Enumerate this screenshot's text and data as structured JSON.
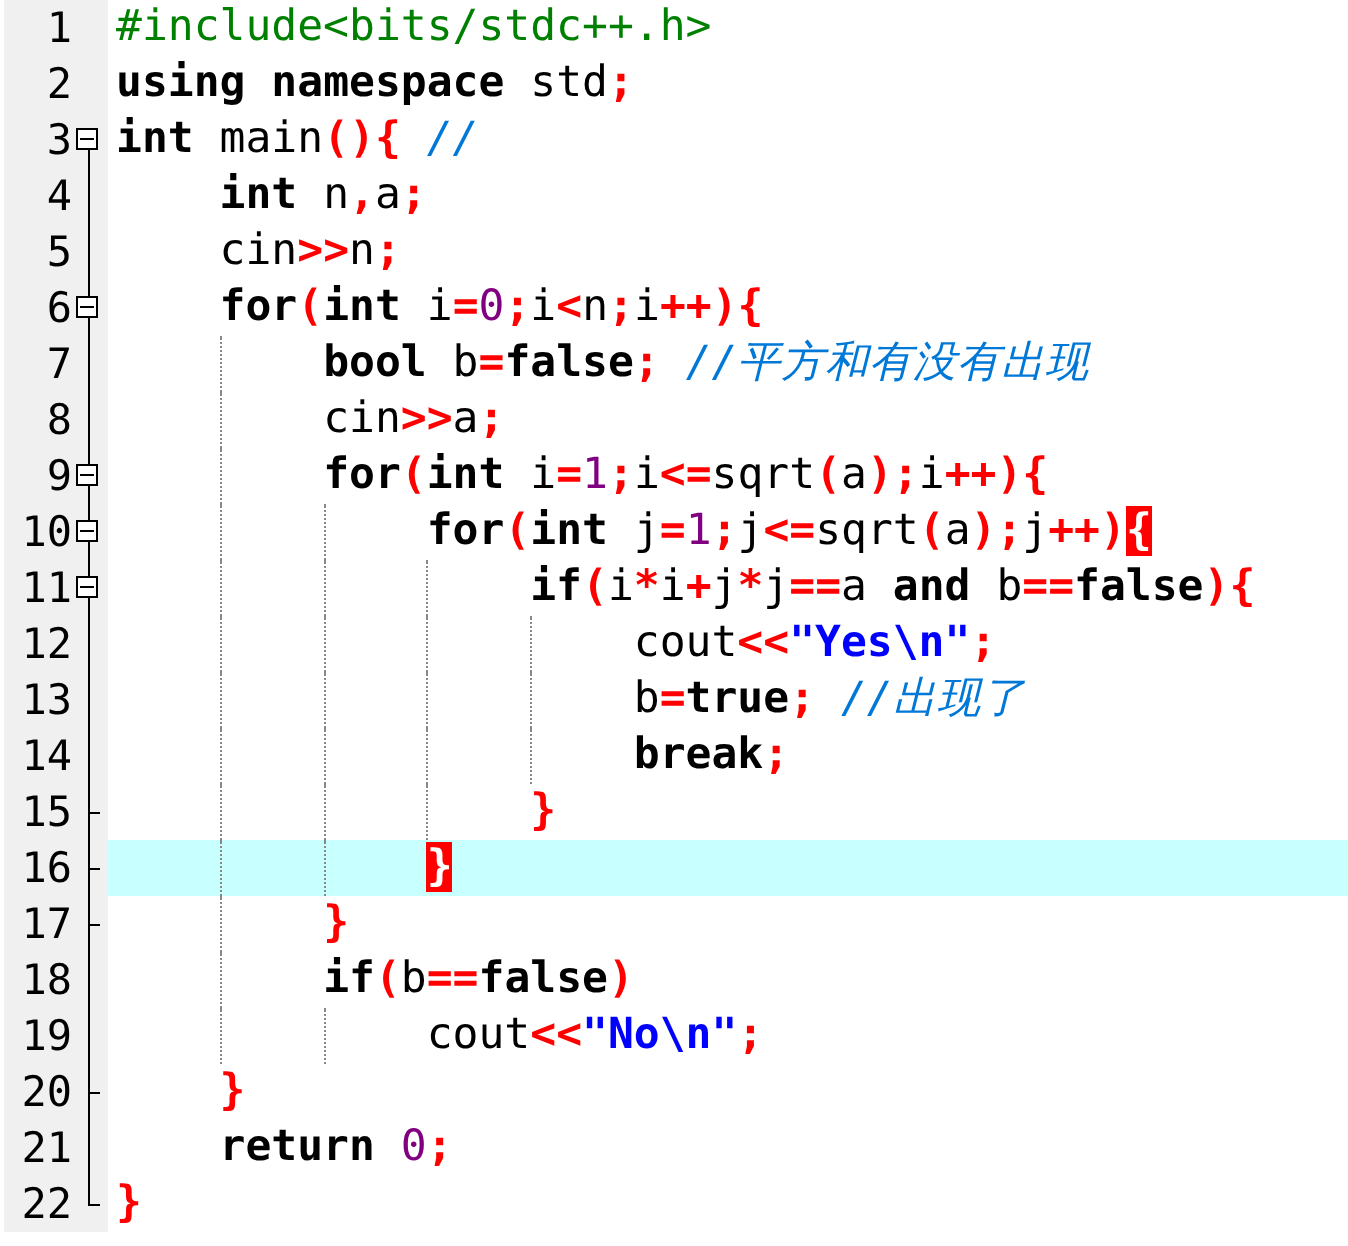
{
  "editor": {
    "lines": [
      {
        "number": "1",
        "current": false,
        "fold_start": false,
        "fold_end": false,
        "tokens": [
          {
            "text": "#include<bits/stdc++.h>",
            "kind": "preproc"
          }
        ]
      },
      {
        "number": "2",
        "current": false,
        "fold_start": false,
        "fold_end": false,
        "tokens": [
          {
            "text": "using",
            "kind": "keyword"
          },
          {
            "text": " namespace",
            "kind": "keyword"
          },
          {
            "text": " std",
            "kind": "plain"
          },
          {
            "text": ";",
            "kind": "symbol"
          }
        ]
      },
      {
        "number": "3",
        "current": false,
        "fold_start": true,
        "fold_end": false,
        "tokens": [
          {
            "text": "int",
            "kind": "keyword"
          },
          {
            "text": " main",
            "kind": "plain"
          },
          {
            "text": "(){",
            "kind": "symbol"
          },
          {
            "text": " //",
            "kind": "comment"
          }
        ]
      },
      {
        "number": "4",
        "current": false,
        "fold_start": false,
        "fold_end": false,
        "tokens": [
          {
            "text": "    int",
            "kind": "keyword"
          },
          {
            "text": " n",
            "kind": "plain"
          },
          {
            "text": ",",
            "kind": "symbol"
          },
          {
            "text": "a",
            "kind": "plain"
          },
          {
            "text": ";",
            "kind": "symbol"
          }
        ]
      },
      {
        "number": "5",
        "current": false,
        "fold_start": false,
        "fold_end": false,
        "tokens": [
          {
            "text": "    cin",
            "kind": "plain"
          },
          {
            "text": ">>",
            "kind": "symbol"
          },
          {
            "text": "n",
            "kind": "plain"
          },
          {
            "text": ";",
            "kind": "symbol"
          }
        ]
      },
      {
        "number": "6",
        "current": false,
        "fold_start": true,
        "fold_end": false,
        "tokens": [
          {
            "text": "    for",
            "kind": "keyword"
          },
          {
            "text": "(",
            "kind": "symbol"
          },
          {
            "text": "int",
            "kind": "keyword"
          },
          {
            "text": " i",
            "kind": "plain"
          },
          {
            "text": "=",
            "kind": "symbol"
          },
          {
            "text": "0",
            "kind": "number"
          },
          {
            "text": ";",
            "kind": "symbol"
          },
          {
            "text": "i",
            "kind": "plain"
          },
          {
            "text": "<",
            "kind": "symbol"
          },
          {
            "text": "n",
            "kind": "plain"
          },
          {
            "text": ";",
            "kind": "symbol"
          },
          {
            "text": "i",
            "kind": "plain"
          },
          {
            "text": "++){",
            "kind": "symbol"
          }
        ]
      },
      {
        "number": "7",
        "current": false,
        "fold_start": false,
        "fold_end": false,
        "tokens": [
          {
            "text": "        bool",
            "kind": "keyword"
          },
          {
            "text": " b",
            "kind": "plain"
          },
          {
            "text": "=",
            "kind": "symbol"
          },
          {
            "text": "false",
            "kind": "keyword"
          },
          {
            "text": ";",
            "kind": "symbol"
          },
          {
            "text": " //平方和有没有出现",
            "kind": "comment"
          }
        ]
      },
      {
        "number": "8",
        "current": false,
        "fold_start": false,
        "fold_end": false,
        "tokens": [
          {
            "text": "        cin",
            "kind": "plain"
          },
          {
            "text": ">>",
            "kind": "symbol"
          },
          {
            "text": "a",
            "kind": "plain"
          },
          {
            "text": ";",
            "kind": "symbol"
          }
        ]
      },
      {
        "number": "9",
        "current": false,
        "fold_start": true,
        "fold_end": false,
        "tokens": [
          {
            "text": "        for",
            "kind": "keyword"
          },
          {
            "text": "(",
            "kind": "symbol"
          },
          {
            "text": "int",
            "kind": "keyword"
          },
          {
            "text": " i",
            "kind": "plain"
          },
          {
            "text": "=",
            "kind": "symbol"
          },
          {
            "text": "1",
            "kind": "number"
          },
          {
            "text": ";",
            "kind": "symbol"
          },
          {
            "text": "i",
            "kind": "plain"
          },
          {
            "text": "<=",
            "kind": "symbol"
          },
          {
            "text": "sqrt",
            "kind": "plain"
          },
          {
            "text": "(",
            "kind": "symbol"
          },
          {
            "text": "a",
            "kind": "plain"
          },
          {
            "text": ");",
            "kind": "symbol"
          },
          {
            "text": "i",
            "kind": "plain"
          },
          {
            "text": "++){",
            "kind": "symbol"
          }
        ]
      },
      {
        "number": "10",
        "current": false,
        "fold_start": true,
        "fold_end": false,
        "tokens": [
          {
            "text": "            for",
            "kind": "keyword"
          },
          {
            "text": "(",
            "kind": "symbol"
          },
          {
            "text": "int",
            "kind": "keyword"
          },
          {
            "text": " j",
            "kind": "plain"
          },
          {
            "text": "=",
            "kind": "symbol"
          },
          {
            "text": "1",
            "kind": "number"
          },
          {
            "text": ";",
            "kind": "symbol"
          },
          {
            "text": "j",
            "kind": "plain"
          },
          {
            "text": "<=",
            "kind": "symbol"
          },
          {
            "text": "sqrt",
            "kind": "plain"
          },
          {
            "text": "(",
            "kind": "symbol"
          },
          {
            "text": "a",
            "kind": "plain"
          },
          {
            "text": ");",
            "kind": "symbol"
          },
          {
            "text": "j",
            "kind": "plain"
          },
          {
            "text": "++)",
            "kind": "symbol"
          },
          {
            "text": "{",
            "kind": "match"
          }
        ]
      },
      {
        "number": "11",
        "current": false,
        "fold_start": true,
        "fold_end": false,
        "tokens": [
          {
            "text": "                if",
            "kind": "keyword"
          },
          {
            "text": "(",
            "kind": "symbol"
          },
          {
            "text": "i",
            "kind": "plain"
          },
          {
            "text": "*",
            "kind": "symbol"
          },
          {
            "text": "i",
            "kind": "plain"
          },
          {
            "text": "+",
            "kind": "symbol"
          },
          {
            "text": "j",
            "kind": "plain"
          },
          {
            "text": "*",
            "kind": "symbol"
          },
          {
            "text": "j",
            "kind": "plain"
          },
          {
            "text": "==",
            "kind": "symbol"
          },
          {
            "text": "a ",
            "kind": "plain"
          },
          {
            "text": "and",
            "kind": "keyword"
          },
          {
            "text": " b",
            "kind": "plain"
          },
          {
            "text": "==",
            "kind": "symbol"
          },
          {
            "text": "false",
            "kind": "keyword"
          },
          {
            "text": "){",
            "kind": "symbol"
          }
        ]
      },
      {
        "number": "12",
        "current": false,
        "fold_start": false,
        "fold_end": false,
        "tokens": [
          {
            "text": "                    cout",
            "kind": "plain"
          },
          {
            "text": "<<",
            "kind": "symbol"
          },
          {
            "text": "\"Yes\\n\"",
            "kind": "string"
          },
          {
            "text": ";",
            "kind": "symbol"
          }
        ]
      },
      {
        "number": "13",
        "current": false,
        "fold_start": false,
        "fold_end": false,
        "tokens": [
          {
            "text": "                    b",
            "kind": "plain"
          },
          {
            "text": "=",
            "kind": "symbol"
          },
          {
            "text": "true",
            "kind": "keyword"
          },
          {
            "text": ";",
            "kind": "symbol"
          },
          {
            "text": " //出现了",
            "kind": "comment"
          }
        ]
      },
      {
        "number": "14",
        "current": false,
        "fold_start": false,
        "fold_end": false,
        "tokens": [
          {
            "text": "                    break",
            "kind": "keyword"
          },
          {
            "text": ";",
            "kind": "symbol"
          }
        ]
      },
      {
        "number": "15",
        "current": false,
        "fold_start": false,
        "fold_end": true,
        "tokens": [
          {
            "text": "                }",
            "kind": "symbol"
          }
        ]
      },
      {
        "number": "16",
        "current": true,
        "fold_start": false,
        "fold_end": true,
        "tokens": [
          {
            "text": "            }",
            "kind": "match"
          }
        ]
      },
      {
        "number": "17",
        "current": false,
        "fold_start": false,
        "fold_end": true,
        "tokens": [
          {
            "text": "        }",
            "kind": "symbol"
          }
        ]
      },
      {
        "number": "18",
        "current": false,
        "fold_start": false,
        "fold_end": false,
        "tokens": [
          {
            "text": "        if",
            "kind": "keyword"
          },
          {
            "text": "(",
            "kind": "symbol"
          },
          {
            "text": "b",
            "kind": "plain"
          },
          {
            "text": "==",
            "kind": "symbol"
          },
          {
            "text": "false",
            "kind": "keyword"
          },
          {
            "text": ")",
            "kind": "symbol"
          }
        ]
      },
      {
        "number": "19",
        "current": false,
        "fold_start": false,
        "fold_end": false,
        "tokens": [
          {
            "text": "            cout",
            "kind": "plain"
          },
          {
            "text": "<<",
            "kind": "symbol"
          },
          {
            "text": "\"No\\n\"",
            "kind": "string"
          },
          {
            "text": ";",
            "kind": "symbol"
          }
        ]
      },
      {
        "number": "20",
        "current": false,
        "fold_start": false,
        "fold_end": true,
        "tokens": [
          {
            "text": "    }",
            "kind": "symbol"
          }
        ]
      },
      {
        "number": "21",
        "current": false,
        "fold_start": false,
        "fold_end": false,
        "tokens": [
          {
            "text": "    return",
            "kind": "keyword"
          },
          {
            "text": " 0",
            "kind": "number"
          },
          {
            "text": ";",
            "kind": "symbol"
          }
        ]
      },
      {
        "number": "22",
        "current": false,
        "fold_start": false,
        "fold_end": true,
        "tokens": [
          {
            "text": "}",
            "kind": "symbol"
          }
        ]
      }
    ]
  }
}
